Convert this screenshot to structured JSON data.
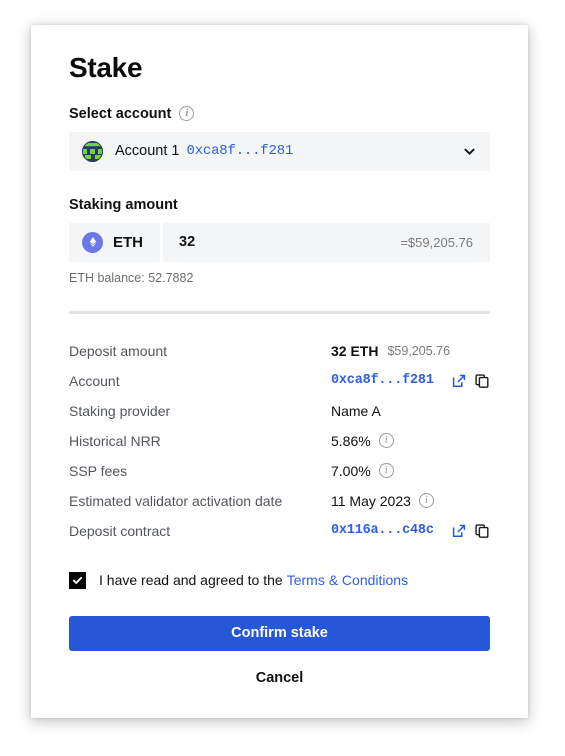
{
  "dialog": {
    "title": "Stake"
  },
  "select_account": {
    "label": "Select account",
    "info_icon": "info-icon",
    "account_name": "Account 1",
    "account_address": "0xca8f...f281",
    "chevron_icon": "chevron-down-icon",
    "avatar_icon": "account-avatar"
  },
  "staking_amount": {
    "label": "Staking amount",
    "token_symbol": "ETH",
    "token_icon": "eth-token-icon",
    "amount": "32",
    "fiat_equivalent": "=$59,205.76",
    "balance": "ETH balance: 52.7882"
  },
  "details": [
    {
      "label": "Deposit amount",
      "value": "32 ETH",
      "value_style": "strong",
      "secondary": "$59,205.76",
      "info": false,
      "actions": []
    },
    {
      "label": "Account",
      "value": "0xca8f...f281",
      "value_style": "address",
      "secondary": "",
      "info": false,
      "actions": [
        "external-link-icon",
        "copy-icon"
      ]
    },
    {
      "label": "Staking provider",
      "value": "Name A",
      "value_style": "plain",
      "secondary": "",
      "info": false,
      "actions": []
    },
    {
      "label": "Historical NRR",
      "value": "5.86%",
      "value_style": "plain",
      "secondary": "",
      "info": true,
      "actions": []
    },
    {
      "label": "SSP fees",
      "value": "7.00%",
      "value_style": "plain",
      "secondary": "",
      "info": true,
      "actions": []
    },
    {
      "label": "Estimated validator activation date",
      "value": "11 May 2023",
      "value_style": "plain",
      "secondary": "",
      "info": true,
      "actions": []
    },
    {
      "label": "Deposit contract",
      "value": "0x116a...c48c",
      "value_style": "address",
      "secondary": "",
      "info": false,
      "actions": [
        "external-link-icon",
        "copy-icon"
      ]
    }
  ],
  "terms": {
    "checked": true,
    "text": "I have read and agreed to the",
    "link_label": "Terms & Conditions"
  },
  "actions": {
    "confirm_label": "Confirm stake",
    "cancel_label": "Cancel"
  },
  "colors": {
    "primary_blue": "#2657d6",
    "link_blue": "#2f5fe0",
    "field_background": "#f4f5f7",
    "divider": "#e2e3e5",
    "text_primary": "#111111",
    "text_muted": "#53565c",
    "checkbox": "#070707",
    "token_icon_bg": "#6b78e5"
  }
}
